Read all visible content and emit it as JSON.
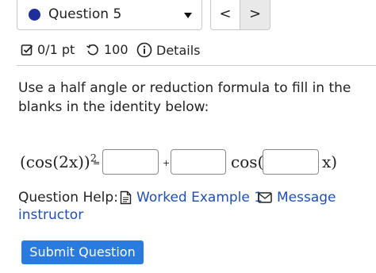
{
  "question_nav": {
    "question_label": "Question 5",
    "prev_label": "<",
    "next_label": ">",
    "status_color": "#1f2f9a"
  },
  "meta": {
    "score": "0/1 pt",
    "tries": "100",
    "details_label": "Details"
  },
  "question": {
    "prompt": "Use a half angle or reduction formula to fill in the blanks in the identity below:",
    "formula": {
      "lhs": "(cos(2x))",
      "lhs_exponent": "2",
      "equals": "=",
      "plus": "+",
      "cos_open": "cos(",
      "x_close": "x)"
    },
    "blanks": [
      "",
      "",
      ""
    ]
  },
  "help": {
    "label": "Question Help:",
    "worked_example": "Worked Example 1",
    "message": "Message",
    "instructor": "instructor"
  },
  "submit_label": "Submit Question",
  "colors": {
    "link": "#1f4fb5",
    "button": "#2a7be0"
  }
}
